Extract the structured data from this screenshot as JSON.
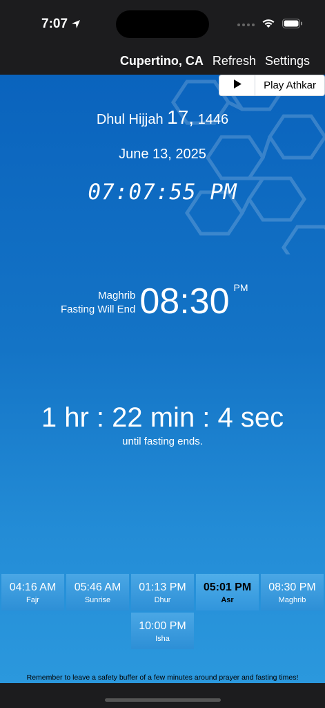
{
  "status": {
    "time": "7:07",
    "icons": [
      "location-arrow-icon",
      "wifi-icon",
      "battery-icon"
    ]
  },
  "nav": {
    "location": "Cupertino, CA",
    "refresh_label": "Refresh",
    "settings_label": "Settings"
  },
  "athkar": {
    "play_icon": "play-icon",
    "label": "Play Athkar"
  },
  "dates": {
    "hijri_month": "Dhul Hijjah",
    "hijri_day": "17,",
    "hijri_year": "1446",
    "gregorian": "June 13, 2025"
  },
  "clock": "07:07:55 PM",
  "next_prayer": {
    "name": "Maghrib",
    "subtitle": "Fasting Will End",
    "time": "08:30",
    "ampm": "PM"
  },
  "countdown": {
    "text": "1 hr : 22 min : 4 sec",
    "subtitle": "until fasting ends."
  },
  "prayers": [
    {
      "time": "04:16 AM",
      "name": "Fajr"
    },
    {
      "time": "05:46 AM",
      "name": "Sunrise"
    },
    {
      "time": "01:13 PM",
      "name": "Dhur"
    },
    {
      "time": "05:01 PM",
      "name": "Asr",
      "active": true
    },
    {
      "time": "08:30 PM",
      "name": "Maghrib"
    },
    {
      "time": "10:00 PM",
      "name": "Isha"
    }
  ],
  "disclaimer": "Remember to leave a safety buffer of a few minutes around prayer and fasting times!",
  "colors": {
    "background_top": "#0a63bd",
    "background_bottom": "#2b98dd",
    "cell": "#3b9be0",
    "nav": "#1c1c1e"
  }
}
